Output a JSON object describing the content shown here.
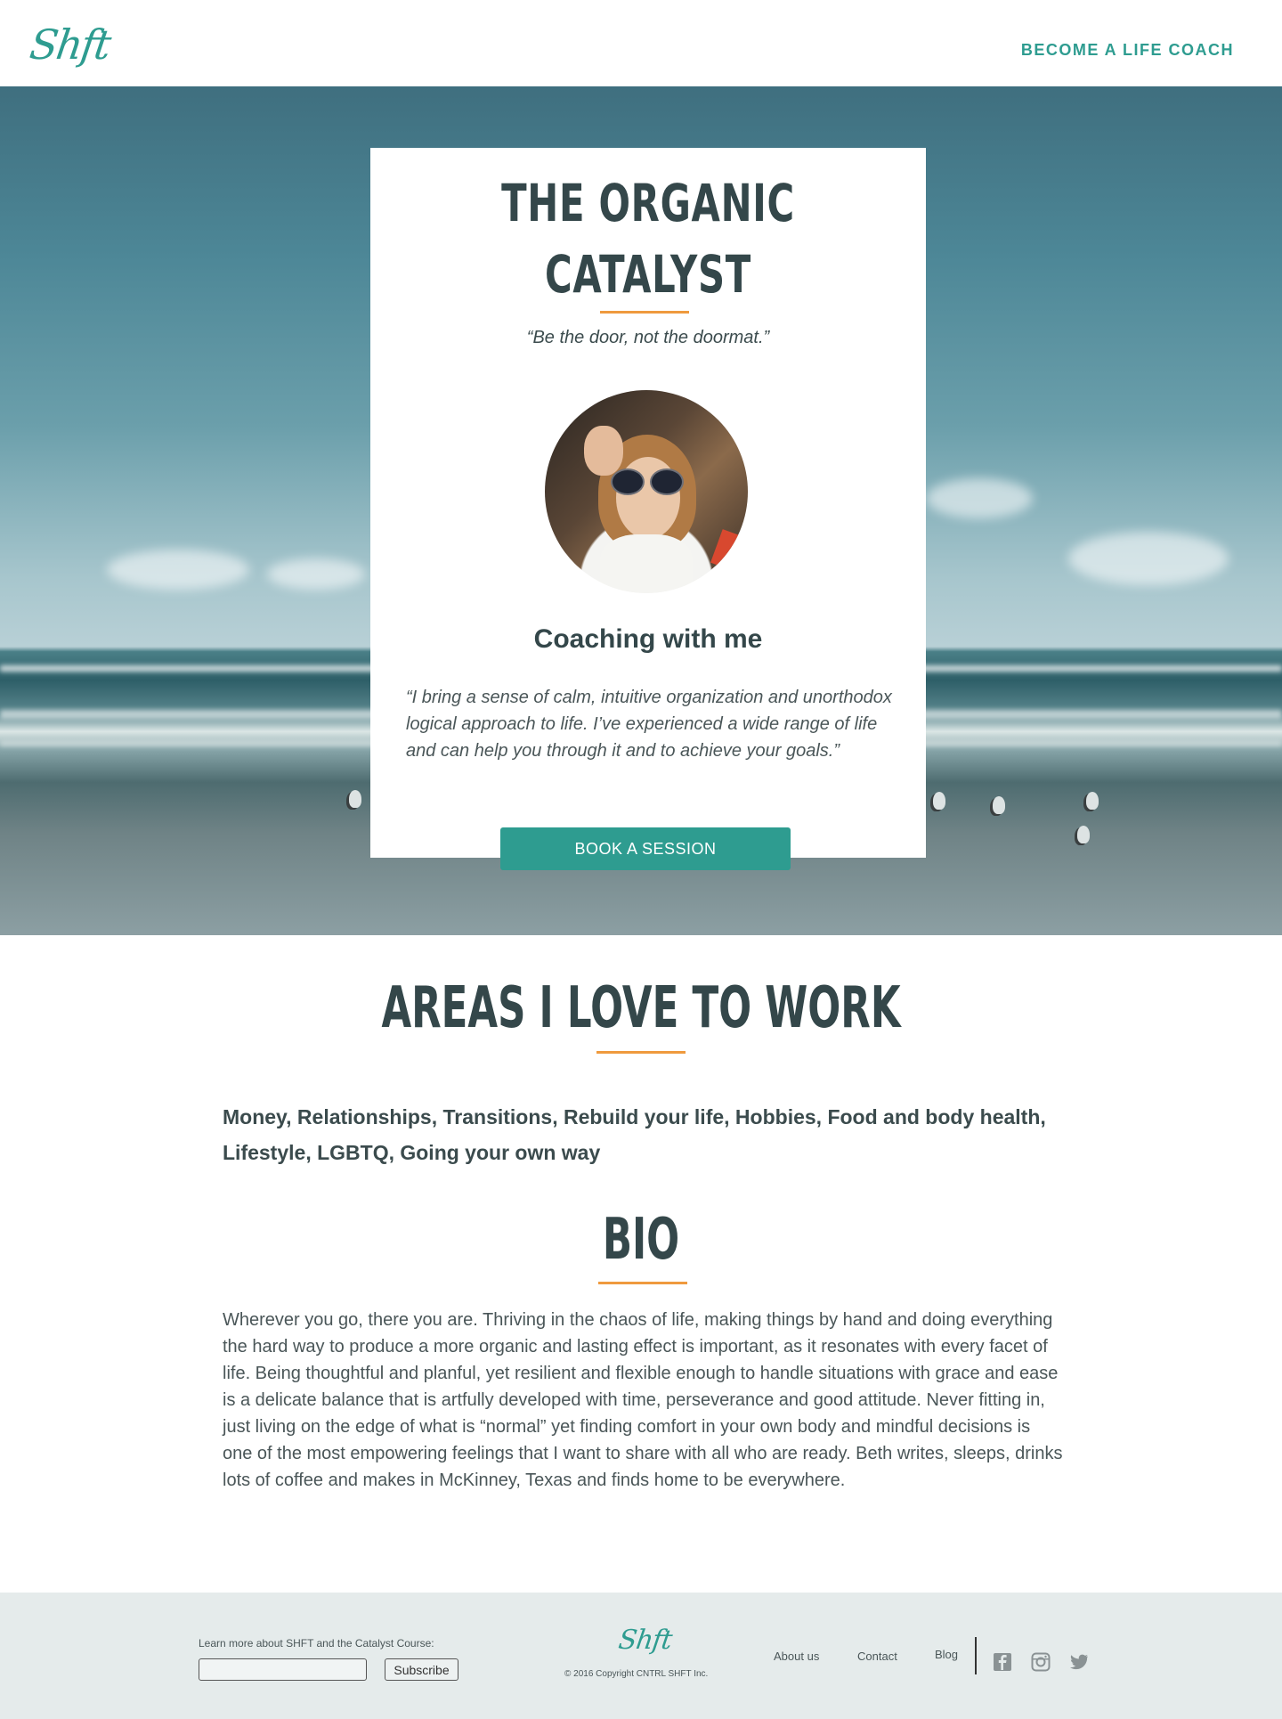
{
  "header": {
    "logo": "Shft",
    "cta": "BECOME A LIFE COACH"
  },
  "hero": {
    "title": "THE ORGANIC CATALYST",
    "tagline": "“Be the door, not the doormat.”",
    "coaching_heading": "Coaching with me",
    "coaching_quote": "“I bring a sense of calm, intuitive organization and unorthodox logical approach to life. I’ve experienced a wide range of life and can help you through it and to achieve your goals.”",
    "book_button": "BOOK A SESSION"
  },
  "areas": {
    "title": "AREAS I LOVE TO WORK",
    "list": "Money, Relationships, Transitions, Rebuild your life, Hobbies, Food and body health, Lifestyle, LGBTQ, Going your own way"
  },
  "bio": {
    "title": "BIO",
    "text": "Wherever you go, there you are. Thriving in the chaos of life, making things by hand and doing everything the hard way to produce a more organic and lasting effect is important, as it resonates with every facet of life. Being thoughtful and planful, yet resilient and flexible enough to handle situations with grace and ease is a delicate balance that is artfully developed with time, perseverance and good attitude. Never fitting in, just living on the edge of what is “normal” yet finding comfort in your own body and mindful decisions is one of the most empowering feelings that I want to share with all who are ready. Beth writes, sleeps, drinks lots of coffee and makes in McKinney, Texas and finds home to be everywhere."
  },
  "footer": {
    "newsletter_label": "Learn more about SHFT and the Catalyst Course:",
    "newsletter_placeholder": "",
    "subscribe_button": "Subscribe",
    "logo": "Shft",
    "copyright": "© 2016 Copyright CNTRL SHFT Inc.",
    "links": [
      "About us",
      "Contact",
      "Blog"
    ],
    "social_icons": [
      "facebook-icon",
      "instagram-icon",
      "twitter-icon"
    ]
  },
  "colors": {
    "accent": "#2e9c90",
    "divider": "#ef9a3e",
    "text": "#3b4b4d",
    "footer_bg": "#e5ebeb"
  }
}
